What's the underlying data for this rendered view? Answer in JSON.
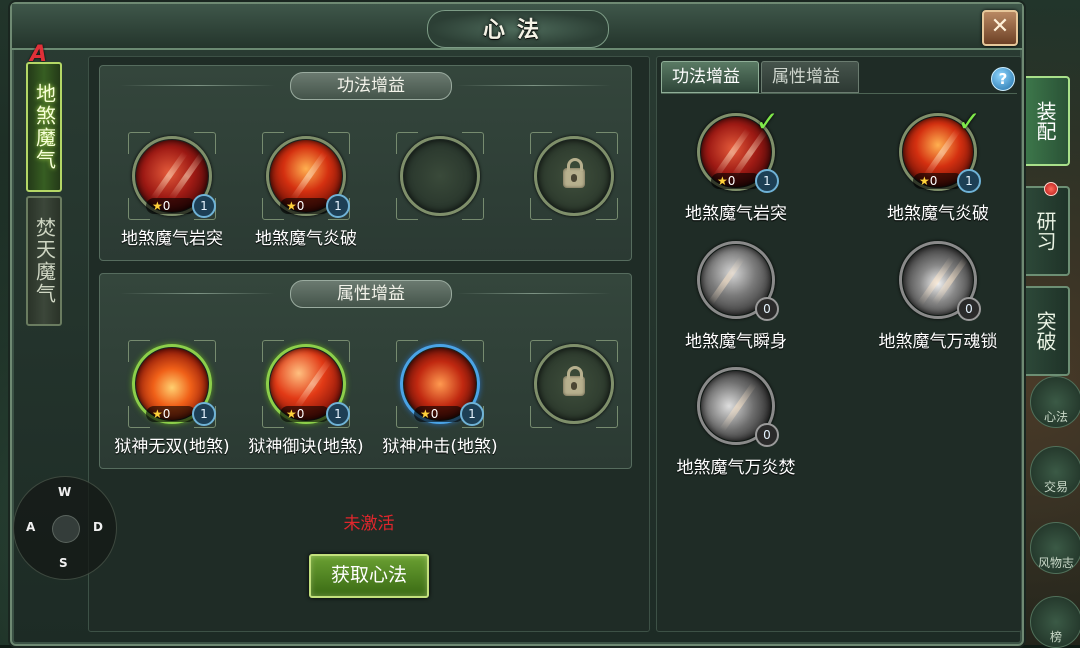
{
  "window": {
    "title": "心法",
    "close_icon": "close-icon"
  },
  "left_tabs": [
    {
      "label": "地煞魔气",
      "marker": "A",
      "active": true
    },
    {
      "label": "焚天魔气",
      "active": false
    }
  ],
  "sections": {
    "skill_gain": {
      "title": "功法增益",
      "slots": [
        {
          "name": "地煞魔气岩突",
          "stars": "0",
          "level": "1",
          "art": "red1",
          "ring": "plain"
        },
        {
          "name": "地煞魔气炎破",
          "stars": "0",
          "level": "1",
          "art": "red2",
          "ring": "plain"
        },
        {
          "name": "",
          "state": "empty"
        },
        {
          "name": "",
          "state": "locked"
        }
      ]
    },
    "attr_gain": {
      "title": "属性增益",
      "slots": [
        {
          "name": "狱神无双(地煞)",
          "stars": "0",
          "level": "1",
          "art": "fire1",
          "ring": "green"
        },
        {
          "name": "狱神御诀(地煞)",
          "stars": "0",
          "level": "1",
          "art": "fire2",
          "ring": "green"
        },
        {
          "name": "狱神冲击(地煞)",
          "stars": "0",
          "level": "1",
          "art": "fire3",
          "ring": "blue"
        },
        {
          "name": "",
          "state": "locked"
        }
      ]
    }
  },
  "status": {
    "text": "未激活",
    "color": "#e0262c"
  },
  "obtain_button": {
    "label": "获取心法"
  },
  "right_panel": {
    "tabs": [
      {
        "label": "功法增益",
        "active": true
      },
      {
        "label": "属性增益",
        "active": false
      }
    ],
    "help_icon": "?",
    "skills": [
      {
        "name": "地煞魔气岩突",
        "stars": "0",
        "level": "1",
        "equipped": true,
        "art": "red1"
      },
      {
        "name": "地煞魔气炎破",
        "stars": "0",
        "level": "1",
        "equipped": true,
        "art": "red2"
      },
      {
        "name": "地煞魔气瞬身",
        "level": "0",
        "equipped": false,
        "art": "grey1"
      },
      {
        "name": "地煞魔气万魂锁",
        "level": "0",
        "equipped": false,
        "art": "grey2"
      },
      {
        "name": "地煞魔气万炎焚",
        "level": "0",
        "equipped": false,
        "art": "grey3"
      }
    ]
  },
  "side_buttons": [
    {
      "label": "装配",
      "active": true
    },
    {
      "label": "研习",
      "active": false,
      "notify": true
    },
    {
      "label": "突破",
      "active": false
    }
  ],
  "side_items": [
    "心法",
    "交易",
    "风物志",
    "榜"
  ],
  "joystick": {
    "up": "W",
    "left": "A",
    "right": "D",
    "down": "S"
  }
}
